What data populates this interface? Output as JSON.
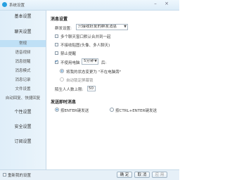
{
  "window": {
    "title": "系统设置",
    "minimize_glyph": "–",
    "close_glyph": "×",
    "app_icon": "qq-icon",
    "accent": "#27a0e0"
  },
  "sidebar": {
    "items": [
      {
        "label": "基本设置",
        "type": "main"
      },
      {
        "label": "聊天设置",
        "type": "main"
      },
      {
        "label": "常规",
        "type": "sub",
        "selected": true
      },
      {
        "label": "语音视频",
        "type": "sub"
      },
      {
        "label": "消息提醒",
        "type": "sub"
      },
      {
        "label": "消息模式",
        "type": "sub"
      },
      {
        "label": "消息记录",
        "type": "sub"
      },
      {
        "label": "文件设置",
        "type": "sub"
      },
      {
        "label": "自动回复、快捷回复",
        "type": "sub"
      },
      {
        "label": "个性设置",
        "type": "main"
      },
      {
        "label": "安全设置",
        "type": "main"
      },
      {
        "label": "订阅设置",
        "type": "main"
      }
    ]
  },
  "content": {
    "receive": {
      "title": "消息设置",
      "group_msg_label": "群发设置:",
      "group_msg_value": "只接收好友的群发消息",
      "opt_merge_windows": "多个聊天窗口默认合并到一起",
      "opt_no_emoticons": "不接收贴图(头像、多人聊天)",
      "opt_mute_sounds": "禁止提醒",
      "opt_idle": "不使用电脑",
      "idle_value": "5分钟",
      "idle_suffix": "后:",
      "opt_status_away": "将我的状态变更为 \"不在电脑旁\"",
      "opt_auto_lock": "自动锁定屏幕锁",
      "contacts_limit_label": "陌生人人数上限:",
      "contacts_limit_value": "50"
    },
    "send": {
      "title": "发送即时消息",
      "opt_enter": "按ENTER键发送",
      "opt_ctrl_enter": "按CTRL+ENTER键发送"
    }
  },
  "footer": {
    "restore_label": "重新我的设置",
    "ok": "确 定",
    "cancel": "取 消",
    "apply": "应 用"
  }
}
